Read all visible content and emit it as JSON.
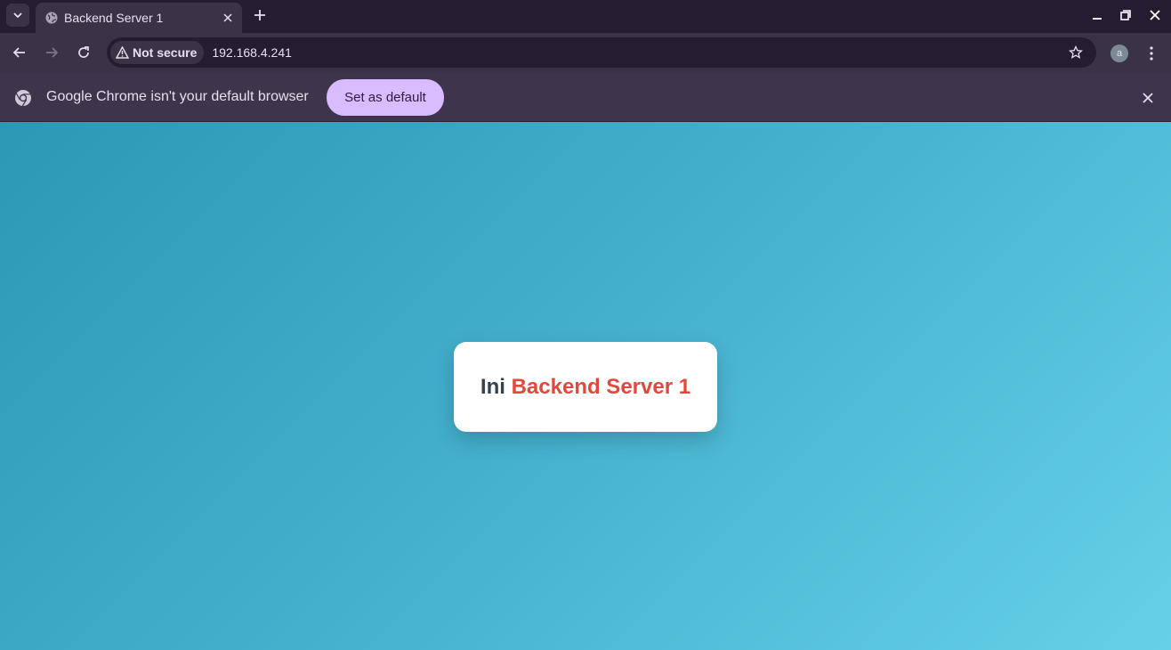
{
  "browser": {
    "tab": {
      "title": "Backend Server 1"
    },
    "toolbar": {
      "security_label": "Not secure",
      "url": "192.168.4.241",
      "profile_initial": "a"
    },
    "infobar": {
      "message": "Google Chrome isn't your default browser",
      "button_label": "Set as default"
    }
  },
  "page": {
    "heading_prefix": "Ini",
    "heading_highlight": "Backend Server 1",
    "colors": {
      "background_start": "#2c98b5",
      "background_end": "#66d0e8",
      "heading_text": "#34414f",
      "highlight": "#e2483b"
    }
  },
  "icons": [
    "chevron-down-icon",
    "globe-icon",
    "close-icon",
    "plus-icon",
    "minimize-icon",
    "restore-icon",
    "back-arrow-icon",
    "forward-arrow-icon",
    "reload-icon",
    "warning-icon",
    "star-icon",
    "kebab-menu-icon",
    "chrome-logo-icon"
  ]
}
